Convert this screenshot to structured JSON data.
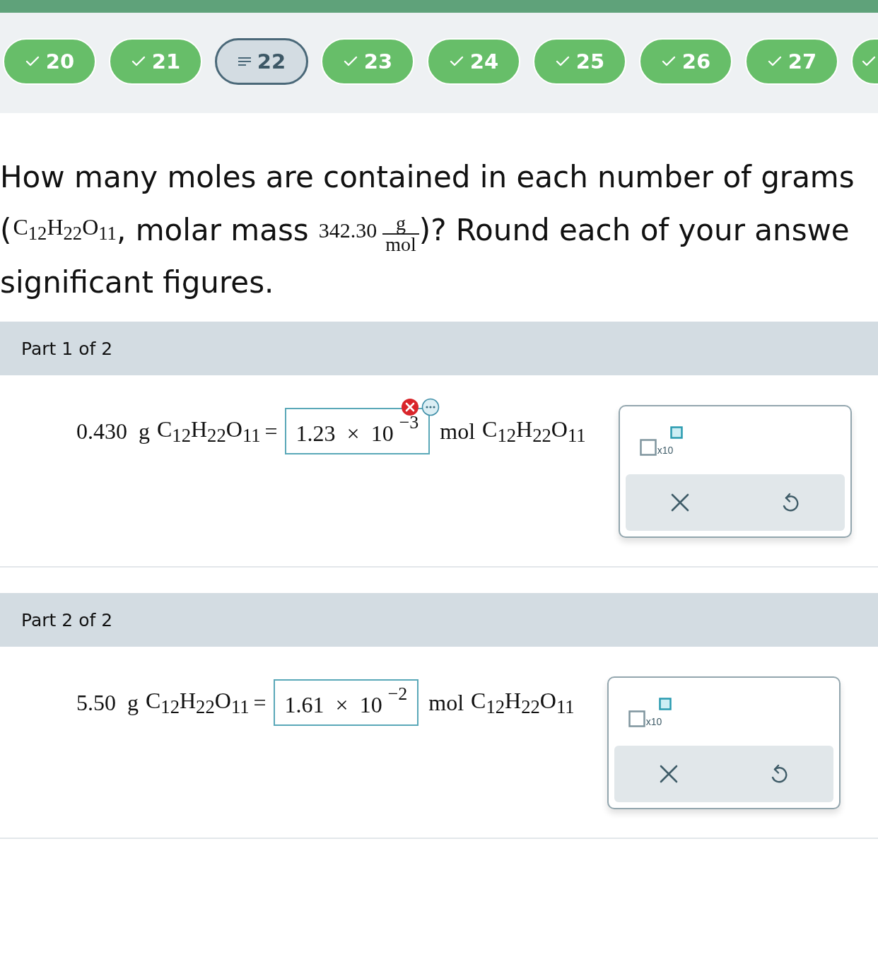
{
  "question_nav": [
    {
      "label": "20",
      "completed": true,
      "selected": false
    },
    {
      "label": "21",
      "completed": true,
      "selected": false
    },
    {
      "label": "22",
      "completed": false,
      "selected": true
    },
    {
      "label": "23",
      "completed": true,
      "selected": false
    },
    {
      "label": "24",
      "completed": true,
      "selected": false
    },
    {
      "label": "25",
      "completed": true,
      "selected": false
    },
    {
      "label": "26",
      "completed": true,
      "selected": false
    },
    {
      "label": "27",
      "completed": true,
      "selected": false
    },
    {
      "completed": true,
      "selected": false
    }
  ],
  "question": {
    "line_1": "How many moles are contained in each number of grams",
    "line_2": {
      "open": "(",
      "formula": "C$_{12}$H$_{22}$O$_{11}$",
      "comma": ",",
      "text": "molar mass",
      "mass": "342.30",
      "numerator": "g",
      "denominator": "mol",
      "close": ")? Round each of your answe"
    },
    "line_3": "significant figures."
  },
  "parts": [
    {
      "title": "Part 1 of 2",
      "given": "0.430",
      "given_unit": "g",
      "formula": "C$_{12}$H$_{22}$O$_{11}$",
      "equals": "=",
      "mantissa": "1.23",
      "times": "×",
      "base": "10",
      "exponent": "−3",
      "result_unit": "mol",
      "result_formula": "C$_{12}$H$_{22}$O$_{11}$",
      "incorrect": true,
      "keypad_label": "x10"
    },
    {
      "title": "Part 2 of 2",
      "given": "5.50",
      "given_unit": "g",
      "formula": "C$_{12}$H$_{22}$O$_{11}$",
      "equals": "=",
      "mantissa": "1.61",
      "times": "×",
      "base": "10",
      "exponent": "−2",
      "result_unit": "mol",
      "result_formula": "C$_{12}$H$_{22}$O$_{11}$",
      "incorrect": false,
      "keypad_label": "x10"
    }
  ]
}
